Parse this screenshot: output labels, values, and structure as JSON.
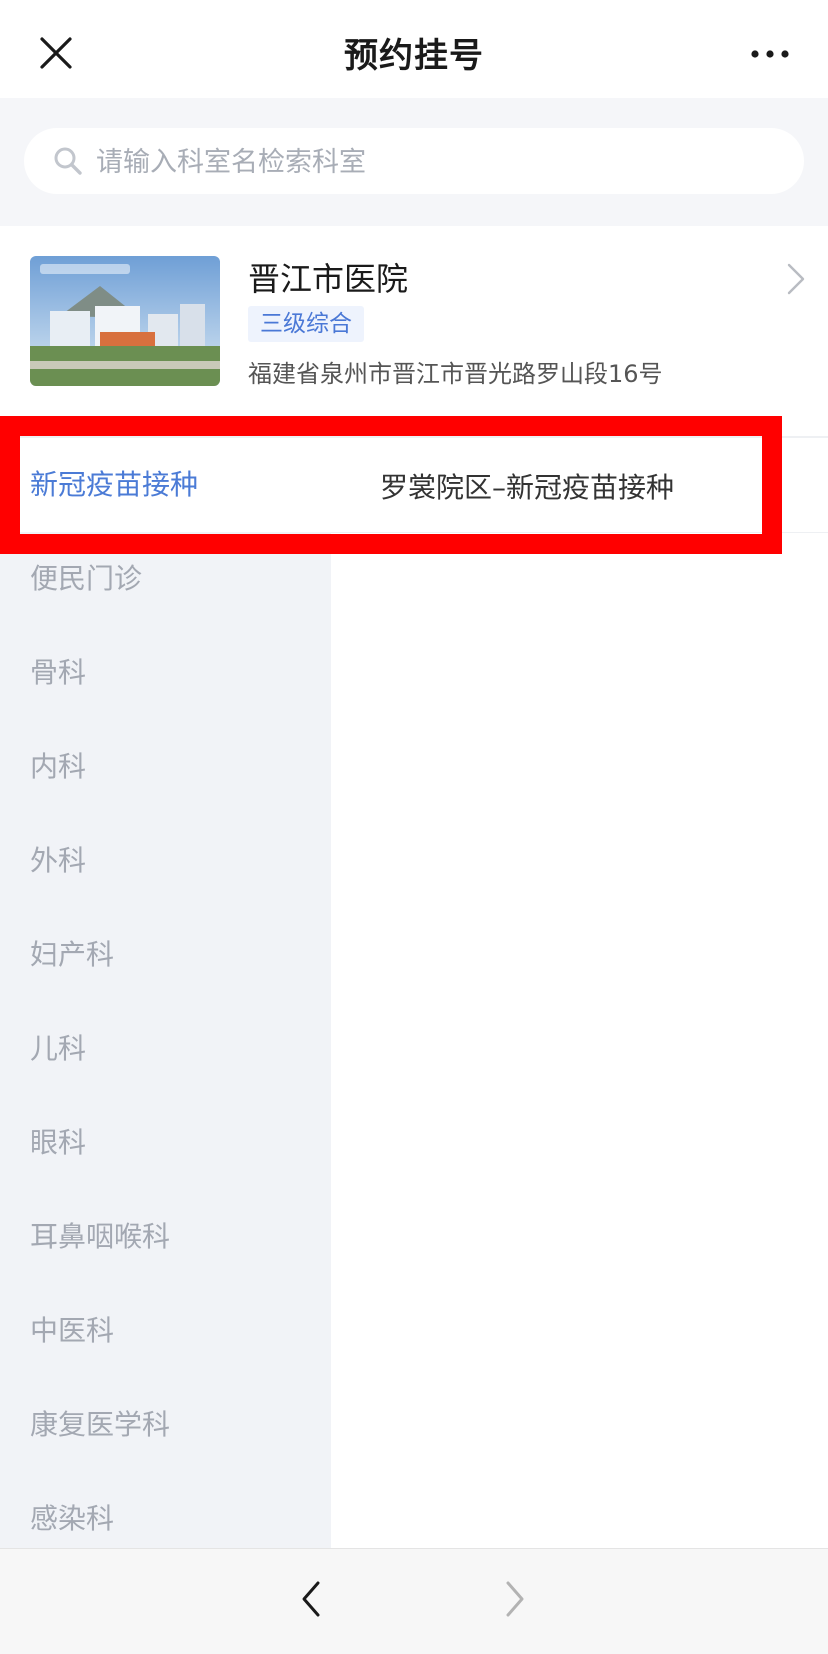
{
  "header": {
    "title": "预约挂号",
    "close_icon": "close-icon",
    "more_icon": "more-icon"
  },
  "search": {
    "placeholder": "请输入科室名检索科室",
    "icon": "search-icon"
  },
  "hospital": {
    "name": "晋江市医院",
    "level": "三级综合",
    "address": "福建省泉州市晋江市晋光路罗山段16号"
  },
  "departments": {
    "active_index": 0,
    "items": [
      {
        "label": "新冠疫苗接种"
      },
      {
        "label": "便民门诊"
      },
      {
        "label": "骨科"
      },
      {
        "label": "内科"
      },
      {
        "label": "外科"
      },
      {
        "label": "妇产科"
      },
      {
        "label": "儿科"
      },
      {
        "label": "眼科"
      },
      {
        "label": "耳鼻咽喉科"
      },
      {
        "label": "中医科"
      },
      {
        "label": "康复医学科"
      },
      {
        "label": "感染科"
      }
    ],
    "sub_items": [
      {
        "label": "罗裳院区–新冠疫苗接种"
      }
    ]
  },
  "colors": {
    "accent": "#4b7bd6",
    "highlight": "#ff0000",
    "sidebar_bg": "#f1f3f7"
  },
  "bottom_nav": {
    "back_icon": "chevron-left-icon",
    "forward_icon": "chevron-right-icon"
  }
}
